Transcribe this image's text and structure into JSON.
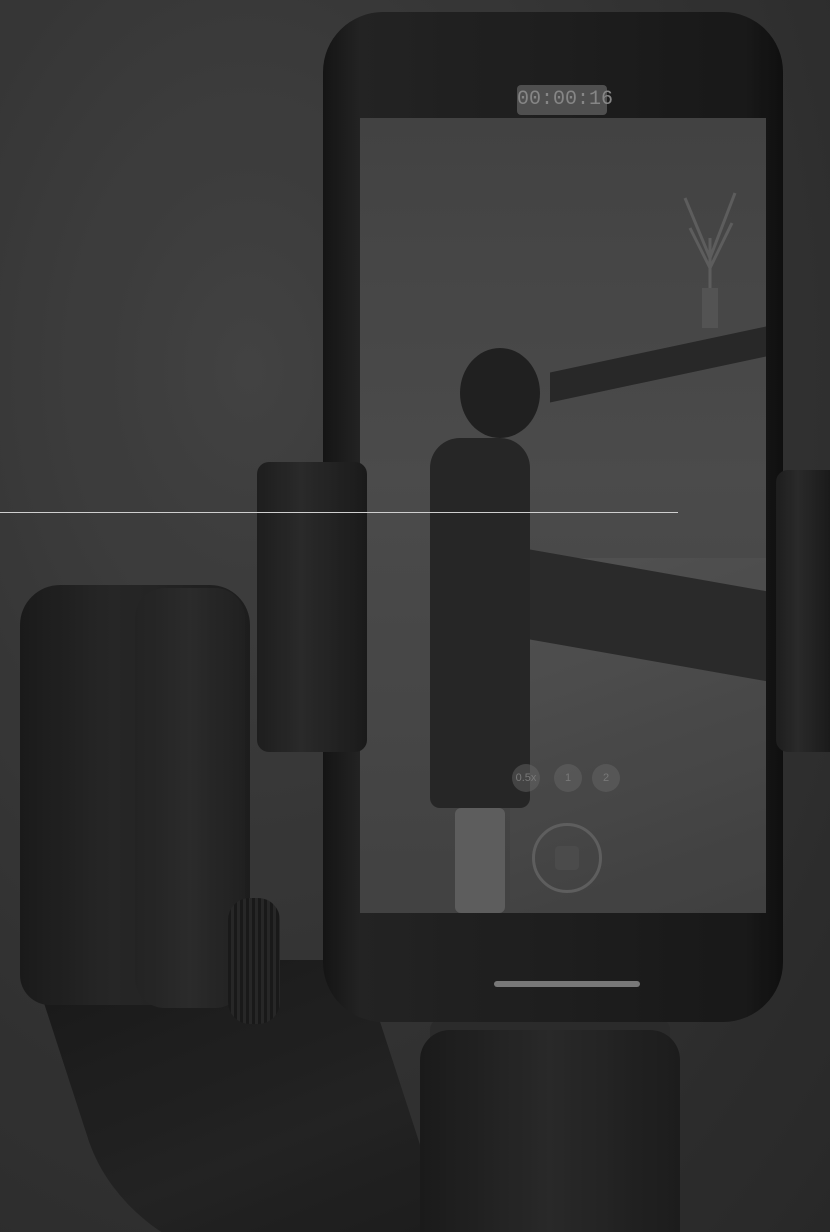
{
  "photo": {
    "subject": "",
    "phone_screen": {
      "timer_text": "00:00:16",
      "zoom_label": "0.5x",
      "zoom_label_2": "1",
      "zoom_label_3": "2"
    }
  },
  "colors": {
    "background": "#3a3a3a",
    "overlay_line": "#cfcfcf"
  }
}
